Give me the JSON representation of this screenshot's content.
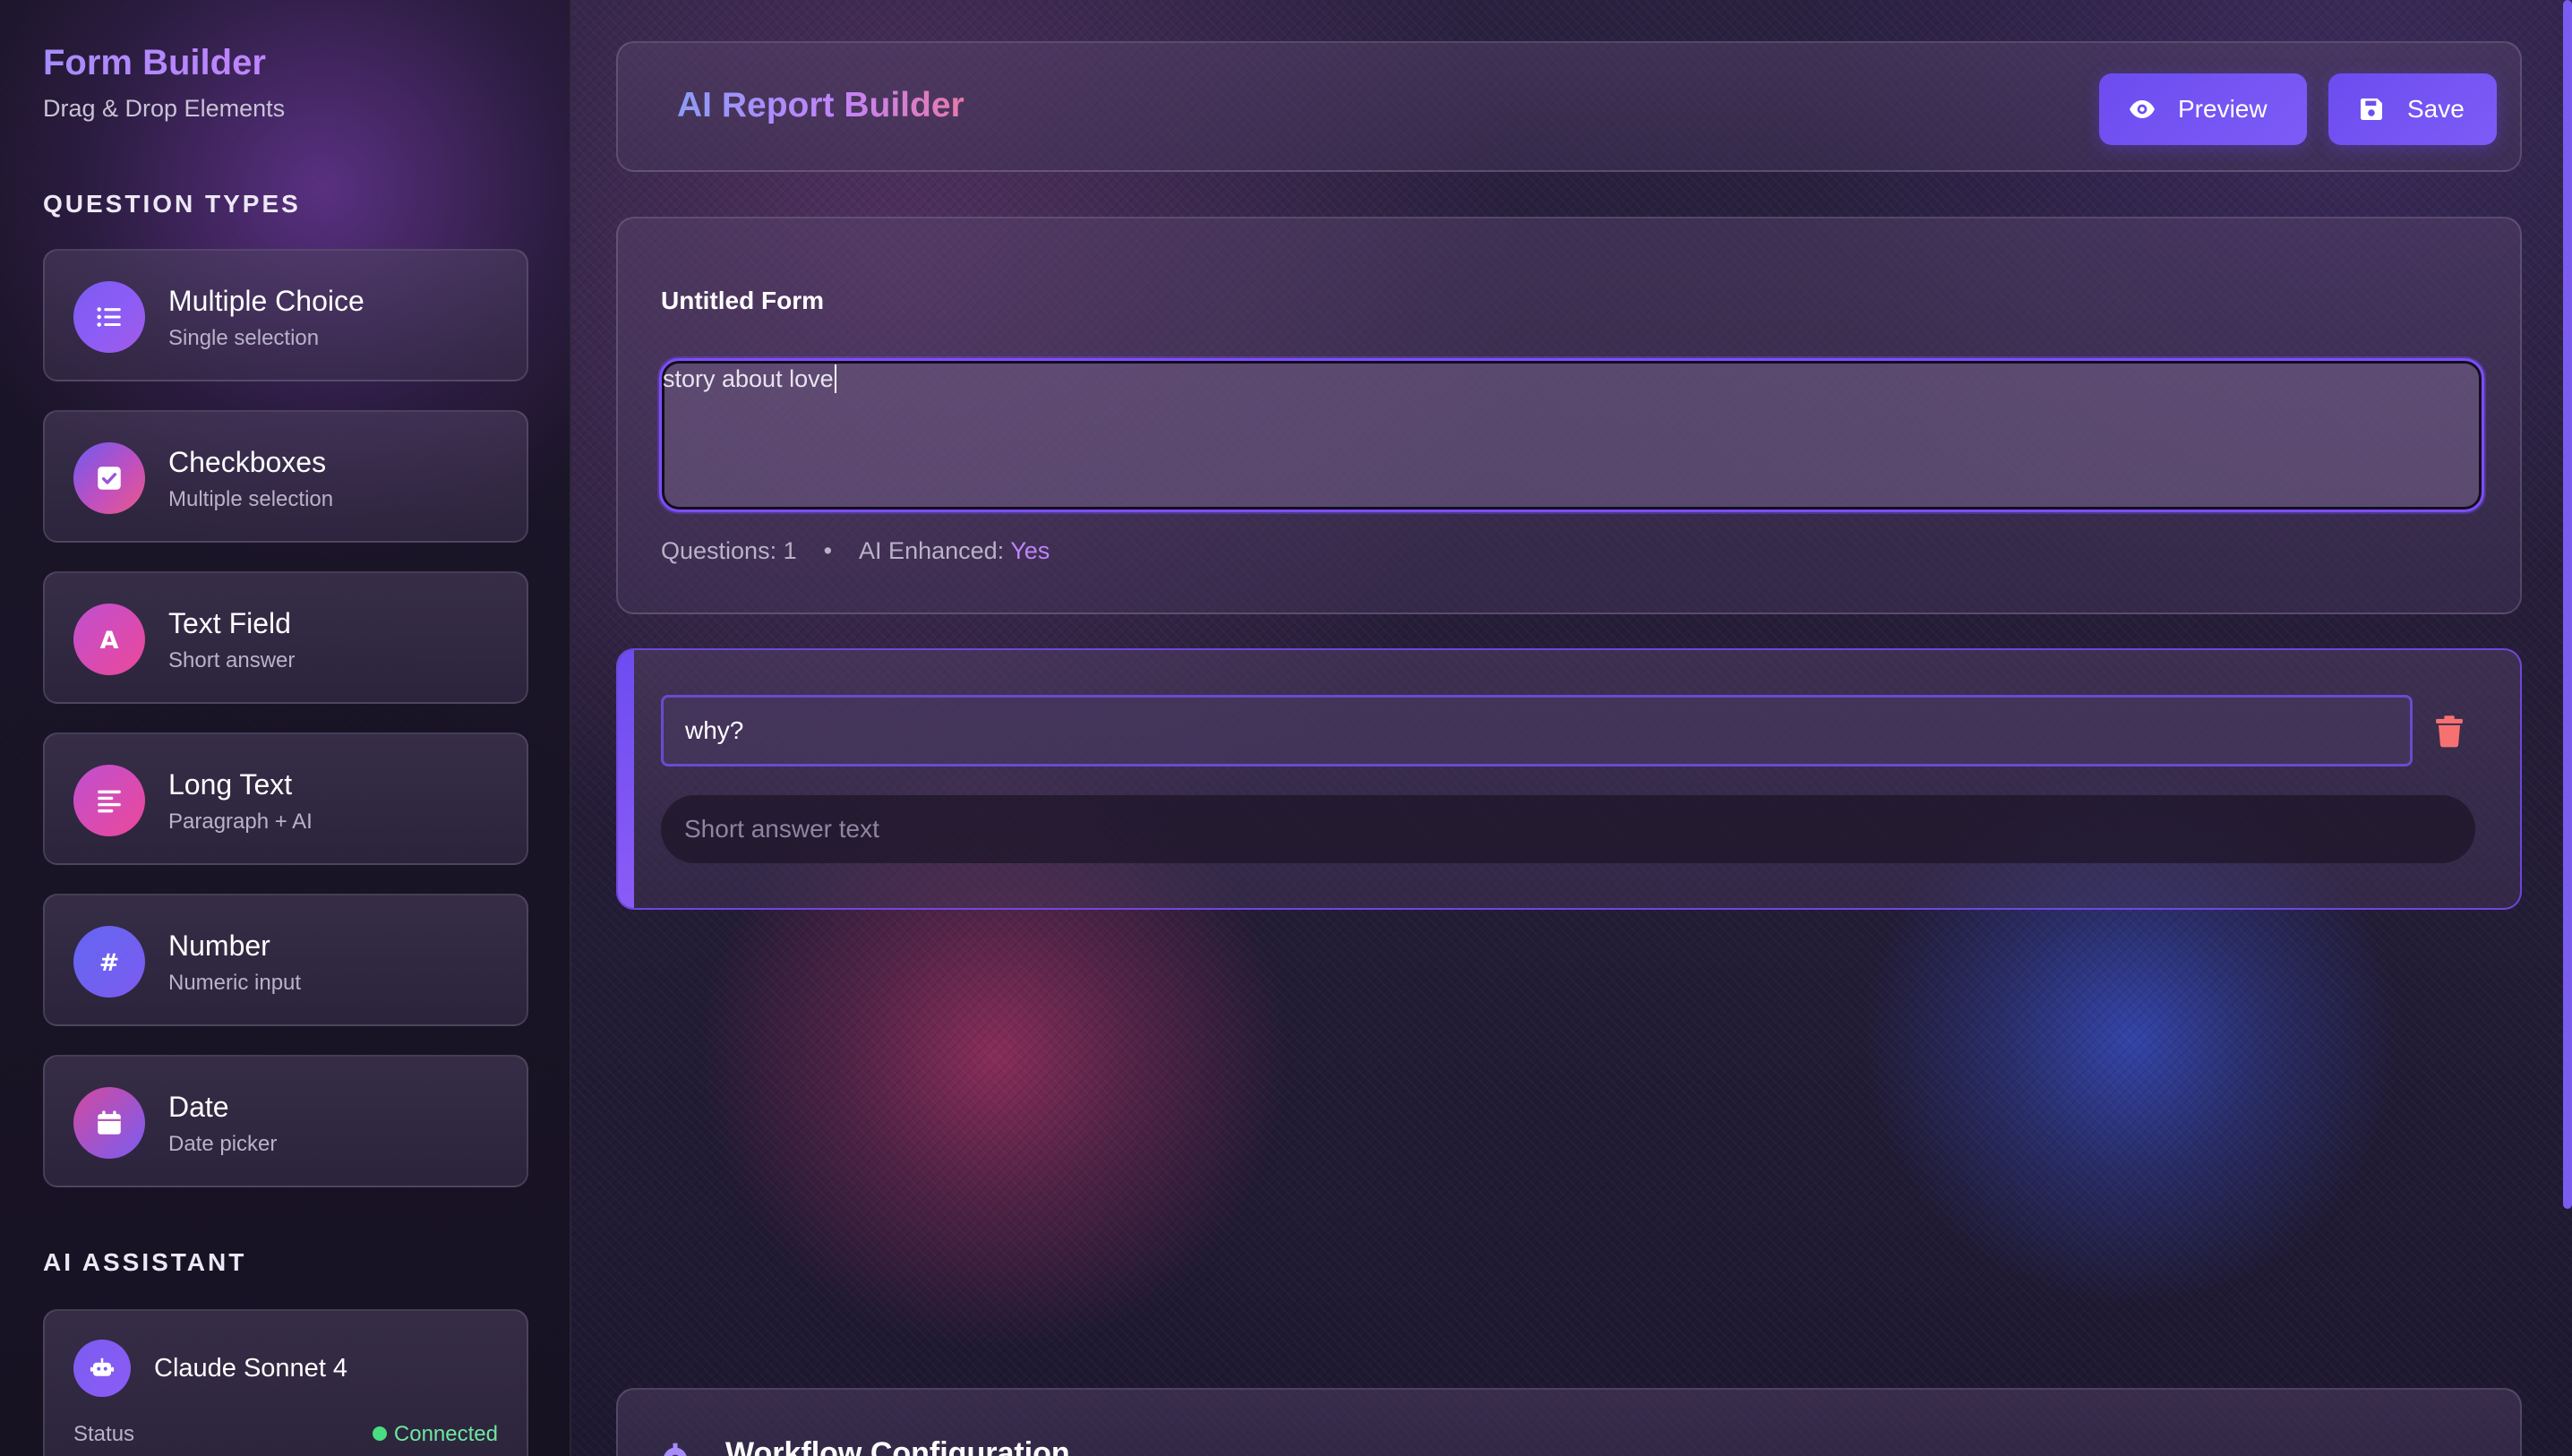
{
  "sidebar": {
    "brand_title": "Form Builder",
    "brand_subtitle": "Drag & Drop Elements",
    "question_types_heading": "QUESTION TYPES",
    "question_types": [
      {
        "label": "Multiple Choice",
        "sub": "Single selection",
        "icon": "list-icon"
      },
      {
        "label": "Checkboxes",
        "sub": "Multiple selection",
        "icon": "checkbox-icon"
      },
      {
        "label": "Text Field",
        "sub": "Short answer",
        "icon": "letter-a-icon"
      },
      {
        "label": "Long Text",
        "sub": "Paragraph + AI",
        "icon": "paragraph-icon"
      },
      {
        "label": "Number",
        "sub": "Numeric input",
        "icon": "hash-icon"
      },
      {
        "label": "Date",
        "sub": "Date picker",
        "icon": "calendar-icon"
      }
    ],
    "ai_heading": "AI ASSISTANT",
    "ai_model": "Claude Sonnet 4",
    "ai_status_label": "Status",
    "ai_status_value": "Connected"
  },
  "header": {
    "title": "AI Report Builder",
    "preview_label": "Preview",
    "save_label": "Save"
  },
  "form": {
    "title": "Untitled Form",
    "description_value": "story about love",
    "questions_label": "Questions: 1",
    "separator": "•",
    "ai_enhanced_label": "AI Enhanced:",
    "ai_enhanced_value": "Yes"
  },
  "question": {
    "title_value": "why?",
    "answer_placeholder": "Short answer text"
  },
  "workflow": {
    "title": "Workflow Configuration"
  },
  "colors": {
    "accent": "#7c5cf6",
    "status_connected": "#4ade80",
    "delete": "#f87171"
  }
}
